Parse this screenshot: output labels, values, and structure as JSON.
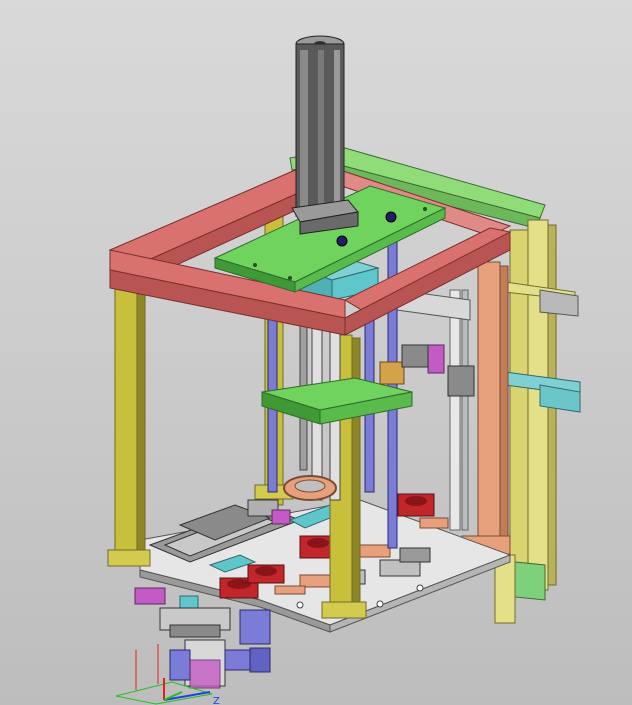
{
  "viewport": {
    "background_top": "#d9d9d9",
    "background_bottom": "#bdbdbd"
  },
  "colors": {
    "top_frame": "#d9726f",
    "top_frame_dark": "#b85553",
    "legs": "#c8c03a",
    "legs_dark": "#8c8626",
    "back_frame": "#8fdc78",
    "plate_green": "#6fd35e",
    "plate_green_dark": "#3f9a35",
    "cylinder": "#5a5a5a",
    "cylinder_light": "#9a9a9a",
    "guide_rod": "#7b7bd8",
    "base_plate": "#e6e6e6",
    "base_plate_dark": "#9a9a9a",
    "red_block": "#c0262a",
    "salmon": "#e7a07c",
    "cyan": "#5fc6cc",
    "magenta": "#c45bc4",
    "brass": "#d3a24a"
  },
  "triad": {
    "x_color": "#e02020",
    "y_color": "#20c020",
    "z_color": "#2040e0",
    "z_label": "Z"
  }
}
